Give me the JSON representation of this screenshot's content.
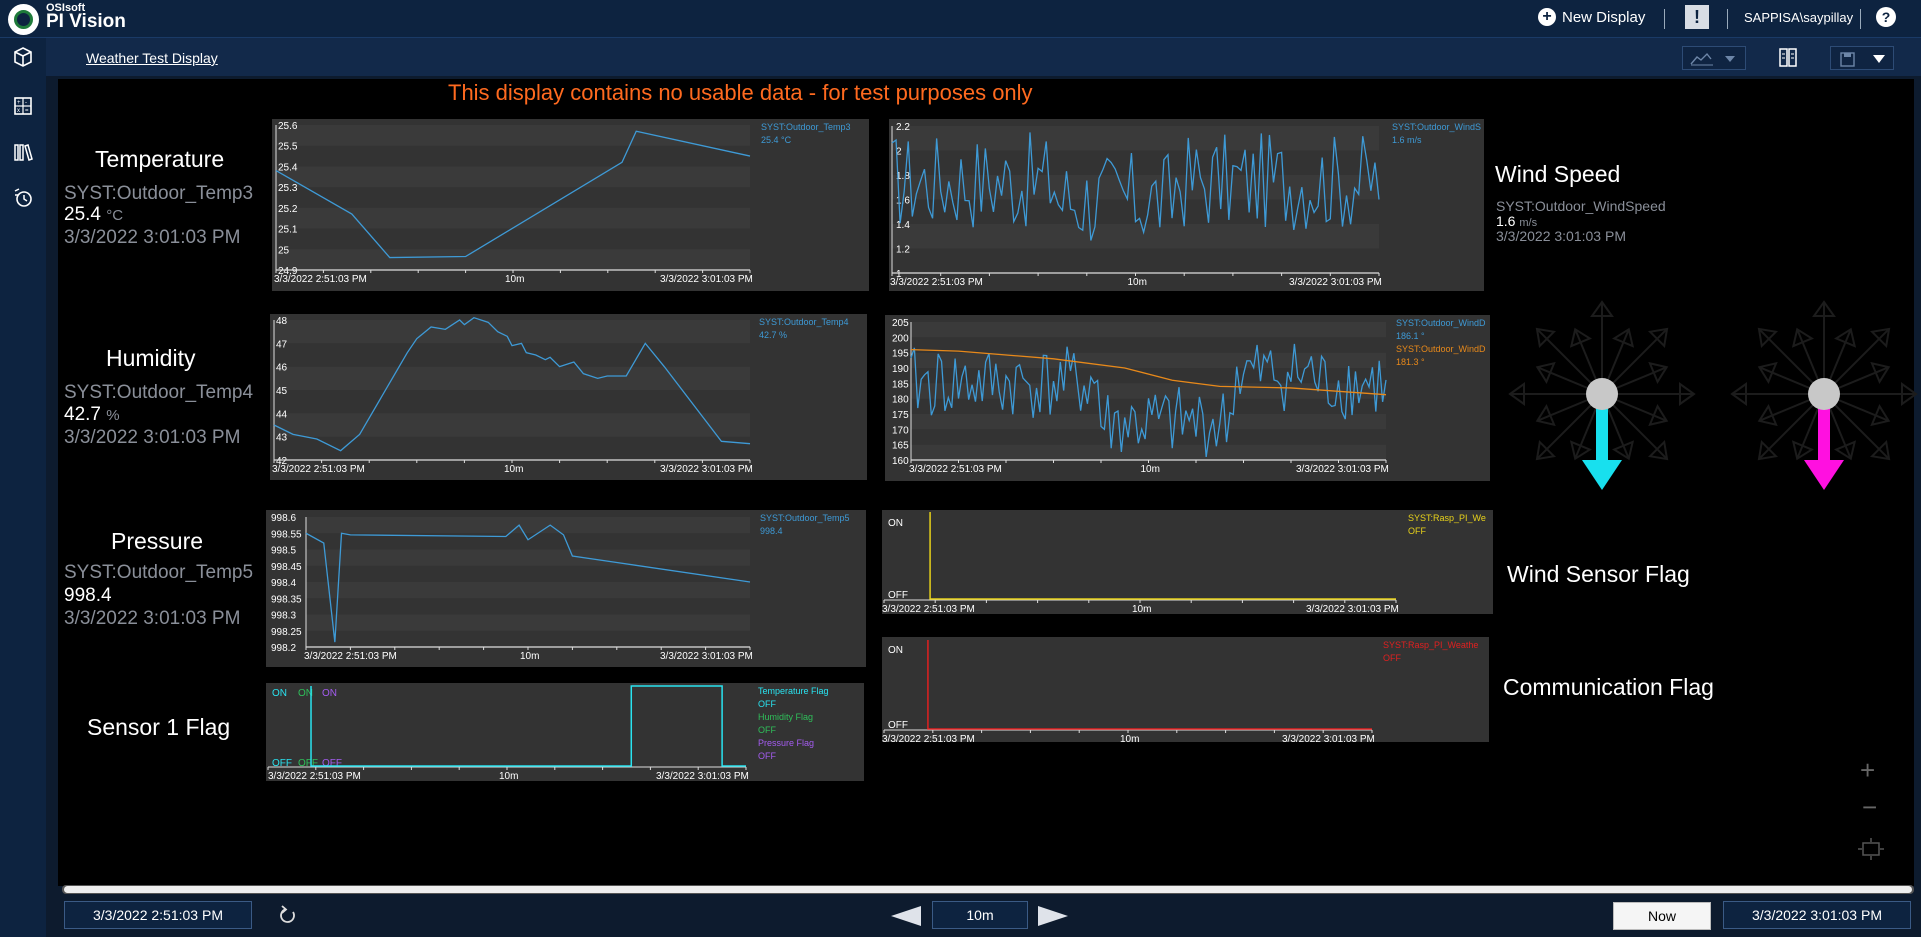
{
  "header": {
    "brand_small": "OSIsoft",
    "brand_big": "PI Vision",
    "new_display_label": "New Display",
    "alert_symbol": "!",
    "user": "SAPPISA\\saypillay",
    "help_symbol": "?"
  },
  "nav": {
    "icons": [
      "cube-icon",
      "calculator-icon",
      "library-icon",
      "event-timer-icon"
    ]
  },
  "subheader": {
    "display_title": "Weather Test Display"
  },
  "warning": "This display contains no usable data - for test purposes only",
  "values": {
    "temperature": {
      "title": "Temperature",
      "tag": "SYST:Outdoor_Temp3",
      "value": "25.4",
      "unit": "°C",
      "timestamp": "3/3/2022 3:01:03 PM"
    },
    "humidity": {
      "title": "Humidity",
      "tag": "SYST:Outdoor_Temp4",
      "value": "42.7",
      "unit": "%",
      "timestamp": "3/3/2022 3:01:03 PM"
    },
    "pressure": {
      "title": "Pressure",
      "tag": "SYST:Outdoor_Temp5",
      "value": "998.4",
      "unit": "",
      "timestamp": "3/3/2022 3:01:03 PM"
    },
    "wind_speed": {
      "title": "Wind Speed",
      "tag": "SYST:Outdoor_WindSpeed",
      "value": "1.6",
      "unit": "m/s",
      "timestamp": "3/3/2022 3:01:03 PM"
    },
    "sensor1_flag": {
      "title": "Sensor 1 Flag"
    },
    "wind_sensor_flag": {
      "title": "Wind Sensor Flag"
    },
    "communication_flag": {
      "title": "Communication Flag"
    }
  },
  "trend_common": {
    "start": "3/3/2022 2:51:03 PM",
    "end": "3/3/2022 3:01:03 PM",
    "span": "10m"
  },
  "trends": {
    "temp": {
      "legend": [
        {
          "name": "SYST:Outdoor_Temp3",
          "value": "25.4 °C",
          "color": "#3e9ad6"
        }
      ],
      "ticks": [
        "25.6",
        "25.5",
        "25.4",
        "25.3",
        "25.2",
        "25.1",
        "25",
        "24.9"
      ]
    },
    "wind": {
      "legend": [
        {
          "name": "SYST:Outdoor_WindS",
          "value": "1.6 m/s",
          "color": "#3e9ad6"
        }
      ],
      "ticks": [
        "2.2",
        "2",
        "1.8",
        "1.6",
        "1.4",
        "1.2",
        "1"
      ]
    },
    "hum": {
      "legend": [
        {
          "name": "SYST:Outdoor_Temp4",
          "value": "42.7 %",
          "color": "#3e9ad6"
        }
      ],
      "ticks": [
        "48",
        "47",
        "46",
        "45",
        "44",
        "43",
        "42"
      ]
    },
    "dir": {
      "legend": [
        {
          "name": "SYST:Outdoor_WindD",
          "value": "186.1 °",
          "color": "#3e9ad6"
        },
        {
          "name": "SYST:Outdoor_WindD",
          "value": "181.3 °",
          "color": "#e8891a"
        }
      ],
      "ticks": [
        "205",
        "200",
        "195",
        "190",
        "185",
        "180",
        "175",
        "170",
        "165",
        "160"
      ]
    },
    "press": {
      "legend": [
        {
          "name": "SYST:Outdoor_Temp5",
          "value": "998.4",
          "color": "#3e9ad6"
        }
      ],
      "ticks": [
        "998.6",
        "998.55",
        "998.5",
        "998.45",
        "998.4",
        "998.35",
        "998.3",
        "998.25",
        "998.2"
      ]
    },
    "windflag": {
      "legend": [
        {
          "name": "SYST:Rasp_PI_We",
          "value": "OFF",
          "color": "#e8d21a"
        }
      ],
      "ticks": [
        "ON",
        "OFF"
      ]
    },
    "commflag": {
      "legend": [
        {
          "name": "SYST:Rasp_PI_Weathe",
          "value": "OFF",
          "color": "#e02020"
        }
      ],
      "ticks": [
        "ON",
        "OFF"
      ]
    },
    "sensor1": {
      "legend": [
        {
          "name": "Temperature Flag",
          "value": "OFF",
          "color": "#29e3f0"
        },
        {
          "name": "Humidity Flag",
          "value": "OFF",
          "color": "#2fbf5a"
        },
        {
          "name": "Pressure Flag",
          "value": "OFF",
          "color": "#a45cf0"
        }
      ],
      "top_labels": [
        {
          "text": "ON",
          "color": "#29e3f0"
        },
        {
          "text": "ON",
          "color": "#2fbf5a"
        },
        {
          "text": "ON",
          "color": "#a45cf0"
        }
      ],
      "bottom_labels": [
        {
          "text": "OFF",
          "color": "#29e3f0"
        },
        {
          "text": "OFF",
          "color": "#2fbf5a"
        },
        {
          "text": "OFF",
          "color": "#a45cf0"
        }
      ]
    }
  },
  "compass": {
    "left_color": "#18e0ee",
    "right_color": "#ff10e0"
  },
  "timebar": {
    "start": "3/3/2022 2:51:03 PM",
    "duration": "10m",
    "now_label": "Now",
    "end": "3/3/2022 3:01:03 PM"
  }
}
